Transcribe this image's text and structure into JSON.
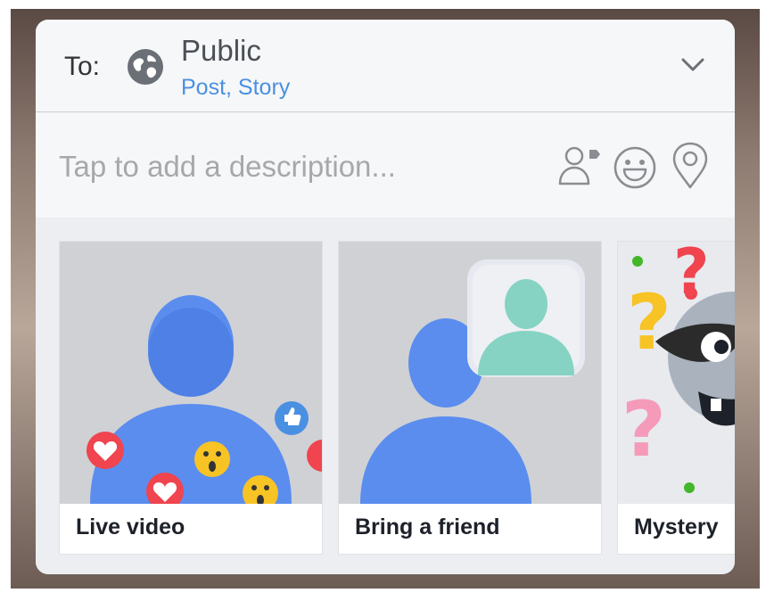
{
  "audience": {
    "to_label": "To:",
    "title": "Public",
    "subtitle": "Post, Story",
    "globe_icon": "globe-icon",
    "dropdown_icon": "chevron-down-icon"
  },
  "description": {
    "placeholder": "Tap to add a description...",
    "actions": [
      "tag-people-icon",
      "feeling-emoji-icon",
      "location-pin-icon"
    ]
  },
  "effects": [
    {
      "label": "Live video"
    },
    {
      "label": "Bring a friend"
    },
    {
      "label": "Mystery"
    }
  ],
  "colors": {
    "accent_blue": "#4a90e2",
    "figure_blue": "#5b8def",
    "friend_teal": "#86d3c3",
    "love_red": "#f0444f",
    "wow_yellow": "#f7c325"
  }
}
